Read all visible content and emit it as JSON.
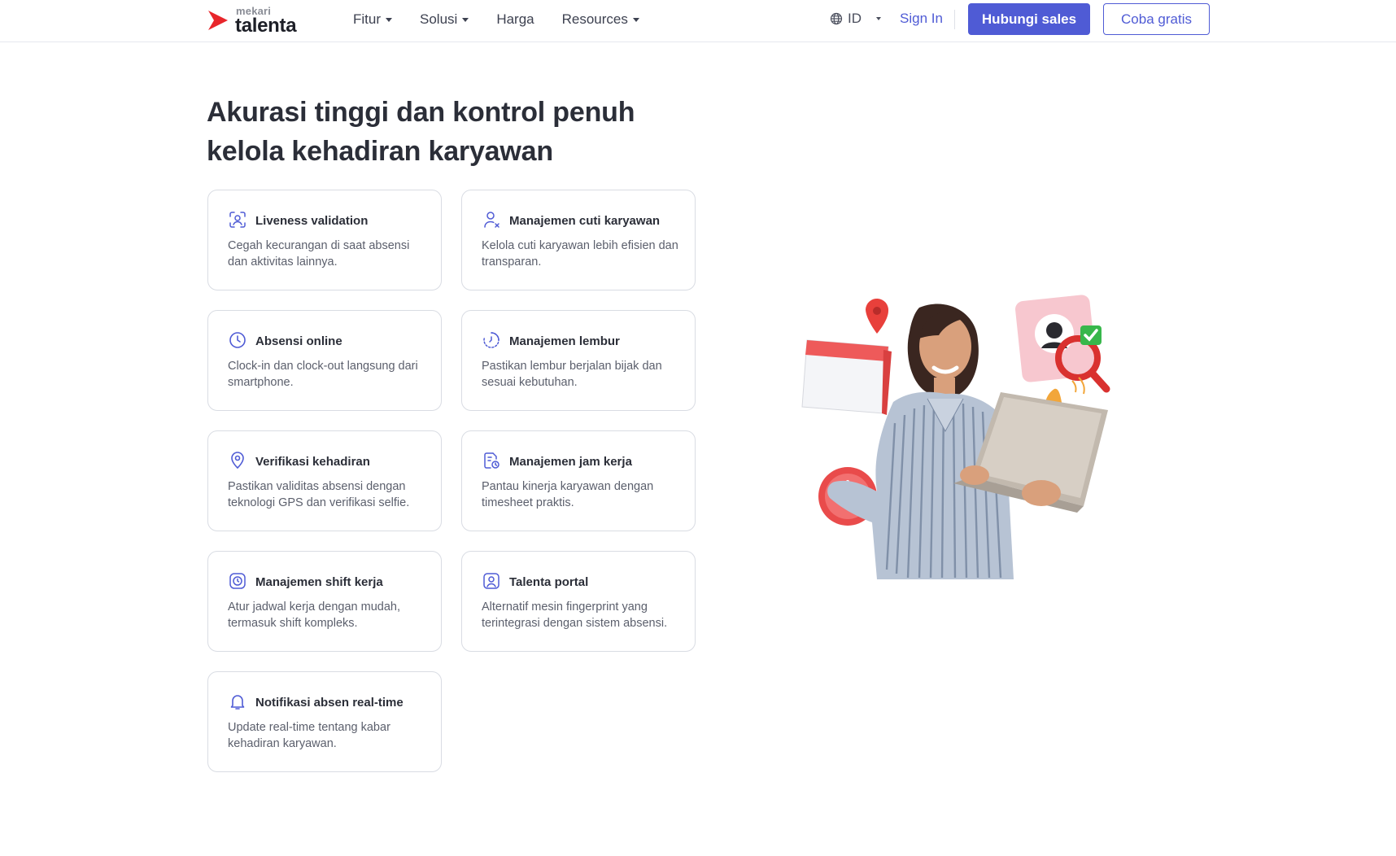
{
  "header": {
    "logo_small": "mekari",
    "logo_big": "talenta",
    "nav": [
      {
        "label": "Fitur",
        "has_caret": true
      },
      {
        "label": "Solusi",
        "has_caret": true
      },
      {
        "label": "Harga",
        "has_caret": false
      },
      {
        "label": "Resources",
        "has_caret": true
      }
    ],
    "lang": "ID",
    "signin": "Sign In",
    "cta_primary": "Hubungi sales",
    "cta_secondary": "Coba gratis",
    "accent_color": "#4f5bd5",
    "brand_color": "#e8262b"
  },
  "headline": {
    "line1": "Akurasi tinggi dan kontrol penuh",
    "line2": "kelola kehadiran karyawan"
  },
  "features": [
    {
      "icon": "face-scan-icon",
      "title": "Liveness validation",
      "desc": "Cegah kecurangan di saat absensi dan aktivitas lainnya."
    },
    {
      "icon": "user-leave-icon",
      "title": "Manajemen cuti karyawan",
      "desc": "Kelola cuti karyawan lebih efisien dan transparan."
    },
    {
      "icon": "clock-icon",
      "title": "Absensi online",
      "desc": "Clock-in dan clock-out langsung dari smartphone."
    },
    {
      "icon": "overtime-clock-icon",
      "title": "Manajemen lembur",
      "desc": "Pastikan lembur berjalan bijak dan sesuai kebutuhan."
    },
    {
      "icon": "location-pin-icon",
      "title": "Verifikasi kehadiran",
      "desc": "Pastikan validitas absensi dengan teknologi GPS dan verifikasi selfie."
    },
    {
      "icon": "timesheet-icon",
      "title": "Manajemen jam kerja",
      "desc": "Pantau kinerja karyawan dengan timesheet praktis."
    },
    {
      "icon": "shift-clock-icon",
      "title": "Manajemen shift kerja",
      "desc": "Atur jadwal kerja dengan mudah, termasuk shift kompleks."
    },
    {
      "icon": "portal-user-icon",
      "title": "Talenta portal",
      "desc": "Alternatif mesin fingerprint yang terintegrasi dengan sistem absensi."
    },
    {
      "icon": "bell-icon",
      "title": "Notifikasi absen real-time",
      "desc": "Update real-time tentang kabar kehadiran karyawan."
    }
  ]
}
